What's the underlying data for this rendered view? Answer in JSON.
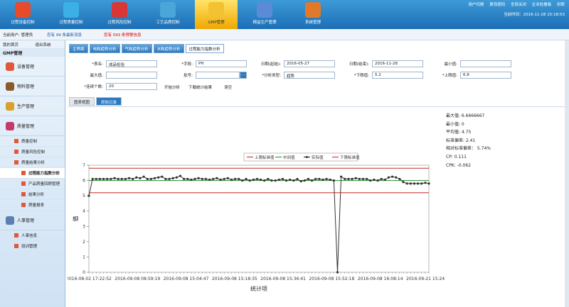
{
  "nav": {
    "tabs": [
      {
        "label": "过程设备控制",
        "color": "#e84b2a"
      },
      {
        "label": "过程质量控制",
        "color": "#3bb0e6"
      },
      {
        "label": "过程风险控制",
        "color": "#d93636"
      },
      {
        "label": "工艺品质控制",
        "color": "#4aa6d8"
      },
      {
        "label": "GMP管理",
        "color": "#f2c230"
      },
      {
        "label": "精益生产管理",
        "color": "#5b8ad6"
      },
      {
        "label": "系统管理",
        "color": "#e07a2a"
      }
    ]
  },
  "toplinks": [
    "用户切换",
    "更改密码",
    "全部关闭",
    "企业检看板",
    "拱郎"
  ],
  "time": "当前时间：2016-11-28 15:18:53",
  "info": {
    "user": "当前用户: 管理员",
    "mail": "您有 99 条最新消息",
    "warn": "您有 593 条预警信息"
  },
  "side": {
    "home": "我的首页",
    "logout": "退出系统",
    "title": "GMP管理",
    "items": [
      "设备管理",
      "物料管理",
      "生产管理",
      "质量管理"
    ],
    "subs": [
      "质量控制",
      "质量风险控制",
      "质量结果分析"
    ],
    "subsubs": [
      "过程能力指数分析",
      "产品质量回顾管理",
      "结果分析",
      "质量报表"
    ],
    "items2": [
      "人事管理"
    ],
    "subs2": [
      "人事信息",
      "培训管理"
    ]
  },
  "tabs": [
    "主界面",
    "电耗趋势分析",
    "气耗趋势分析",
    "水耗趋势分析",
    "过程能力指数分析"
  ],
  "form": {
    "table_label": "*表名:",
    "table_val": "成品检验",
    "field_label": "*字段:",
    "field_val": "PH",
    "start_label": "日期(起始):",
    "start_val": "2016-05-27",
    "end_label": "日期(结束):",
    "end_val": "2016-11-28",
    "min_label": "最小值:",
    "min_val": "",
    "max_label": "最大值:",
    "max_val": "",
    "batch_label": "批号:",
    "batch_val": "",
    "atype_label": "*分析类型:",
    "atype_val": "趋势",
    "lower_label": "*下限值:",
    "lower_val": "5.2",
    "upper_label": "*上限值:",
    "upper_val": "6.8",
    "count_label": "*连续个数:",
    "count_val": "20",
    "btn_start": "开始分析",
    "btn_download": "下载统计结果",
    "btn_clear": "清空",
    "dots": "..."
  },
  "subtabs": [
    "图表视图",
    "原始记录"
  ],
  "stats": [
    "最大值: 6.6666667",
    "最小值: 0",
    "平均值: 4.75",
    "标准偏差: 2.41",
    "相对标准偏差： 5.74%",
    "CP: 0.111",
    "CPK: -0.062"
  ],
  "chart_data": {
    "type": "line",
    "legend": [
      "上限标准值",
      "中间值",
      "实际值",
      "下限标准值"
    ],
    "ylabel": "值",
    "xlabel": "统计项",
    "ylim": [
      0,
      7
    ],
    "yticks": [
      "0",
      "1",
      "2",
      "3",
      "4",
      "5",
      "6",
      "7"
    ],
    "xticks": [
      "2016-08-02 17:22:52",
      "2016-09-08 08:59:19",
      "2016-09-08 15:04:47",
      "2016-09-08 15:18:35",
      "2016-09-08 15:36:41",
      "2016-09-08 15:52:18",
      "2016-09-08 16:08:14",
      "2016-09-21 15:24:05"
    ],
    "series": [
      {
        "name": "上限标准值",
        "color": "#d23c3c",
        "value": 6.8
      },
      {
        "name": "中间值",
        "color": "#3c9a3c",
        "value": 6.0
      },
      {
        "name": "下限标准值",
        "color": "#d23c3c",
        "value": 5.2
      },
      {
        "name": "实际值",
        "color": "#333333",
        "values": [
          5,
          6.1,
          6.1,
          6.1,
          6.1,
          6.1,
          6.1,
          6.15,
          6.1,
          6.1,
          6.1,
          6.15,
          6.1,
          6.2,
          6.15,
          6.25,
          6.1,
          6.1,
          6.15,
          6.2,
          6.25,
          6.1,
          6.1,
          6.15,
          6.2,
          6.3,
          6.1,
          6.1,
          6.05,
          6.1,
          6.15,
          6.1,
          6.1,
          6.05,
          6.1,
          6.15,
          6.05,
          6.1,
          6.15,
          6.05,
          6.1,
          6.1,
          6.0,
          6.1,
          6.0,
          6.05,
          6.1,
          6.05,
          6.0,
          6.1,
          6.0,
          6.0,
          6.05,
          6.1,
          6.0,
          6.05,
          6.0,
          6.1,
          5.95,
          6.0,
          6.1,
          6.0,
          6.1,
          6.1,
          6.05,
          6.1,
          6.05,
          6.0,
          0,
          6.25,
          6.1,
          6.1,
          6.1,
          6.15,
          6.1,
          6.1,
          6.1,
          6.0,
          6.05,
          6.0,
          6.1,
          6.05,
          6.2,
          6.25,
          6.2,
          6.1,
          5.9,
          5.8,
          5.8,
          5.8,
          5.8,
          5.8,
          5.85,
          5.8
        ]
      }
    ]
  }
}
